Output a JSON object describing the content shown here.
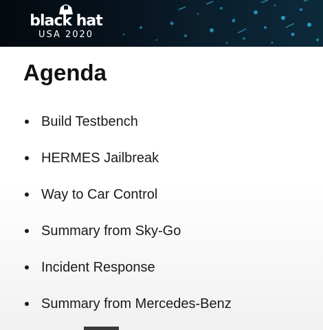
{
  "header": {
    "logo_text": "black hat",
    "logo_subtitle": "USA 2020"
  },
  "slide": {
    "title": "Agenda",
    "items": [
      {
        "label": "Build Testbench"
      },
      {
        "label": "HERMES Jailbreak"
      },
      {
        "label": "Way to Car Control"
      },
      {
        "label": "Summary from Sky-Go"
      },
      {
        "label": "Incident Response"
      },
      {
        "label": "Summary from Mercedes-Benz"
      }
    ]
  },
  "colors": {
    "banner_dark": "#050a10",
    "banner_accent": "#1e8fb8",
    "title_text": "#111111",
    "body_text": "#1a1a1a"
  },
  "icons": {
    "logo_hat": "hat-icon",
    "bullet": "bullet-icon"
  }
}
